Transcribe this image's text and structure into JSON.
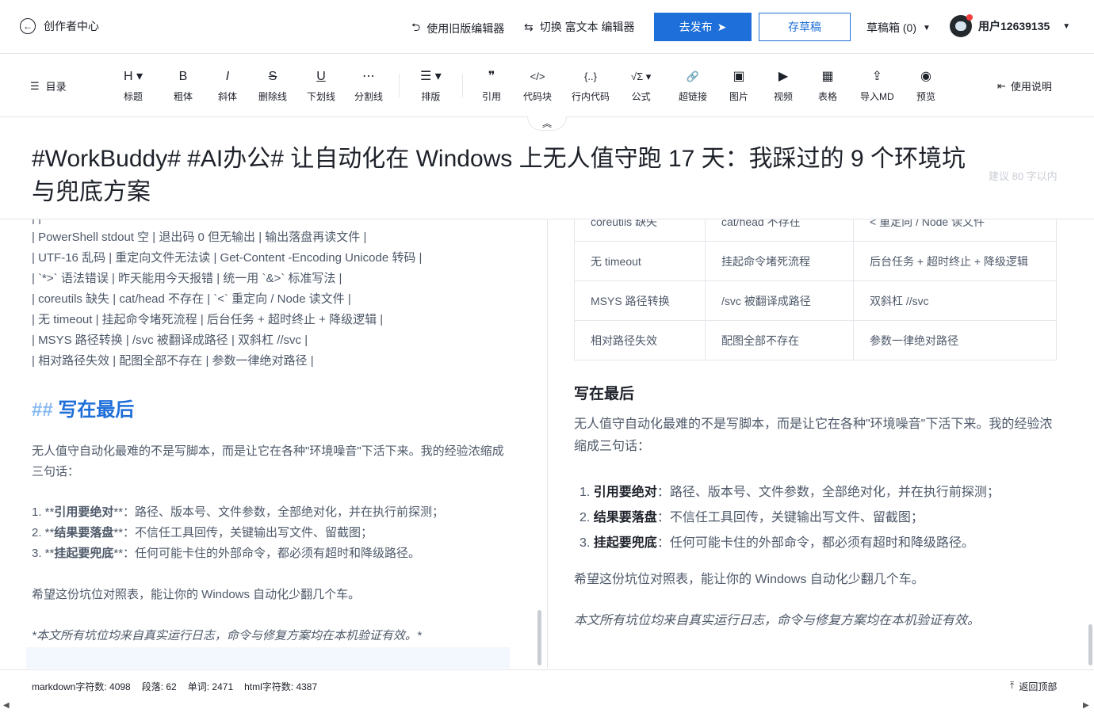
{
  "header": {
    "back_label": "创作者中心",
    "old_editor": "使用旧版编辑器",
    "switch_editor": "切换 富文本 编辑器",
    "publish": "去发布",
    "save_draft": "存草稿",
    "drafts": "草稿箱 (0)",
    "username": "用户12639135"
  },
  "toolbar": {
    "toc": "目录",
    "items": [
      {
        "icon": "H ▾",
        "label": "标题"
      },
      {
        "icon": "B",
        "label": "粗体"
      },
      {
        "icon": "I",
        "label": "斜体"
      },
      {
        "icon": "S",
        "label": "删除线"
      },
      {
        "icon": "U",
        "label": "下划线"
      },
      {
        "icon": "⋯",
        "label": "分割线"
      },
      {
        "icon": "☰ ▾",
        "label": "排版"
      },
      {
        "icon": "❞",
        "label": "引用"
      },
      {
        "icon": "</>",
        "label": "代码块"
      },
      {
        "icon": "{..}",
        "label": "行内代码"
      },
      {
        "icon": "√Σ ▾",
        "label": "公式"
      },
      {
        "icon": "🔗",
        "label": "超链接"
      },
      {
        "icon": "▣",
        "label": "图片"
      },
      {
        "icon": "▶",
        "label": "视频"
      },
      {
        "icon": "▦",
        "label": "表格"
      },
      {
        "icon": "⇪",
        "label": "导入MD"
      },
      {
        "icon": "◉",
        "label": "预览"
      }
    ],
    "manual": "使用说明"
  },
  "title": {
    "text": "#WorkBuddy# #AI办公# 让自动化在 Windows 上无人值守跑 17 天：我踩过的 9 个环境坑与兜底方案",
    "hint": "建议 80 字以内"
  },
  "editor": {
    "table_lines": [
      "| PowerShell stdout 空 | 退出码 0 但无输出 | 输出落盘再读文件 |",
      "| UTF-16 乱码 | 重定向文件无法读 | Get-Content -Encoding Unicode 转码 |",
      "| `*>` 语法错误 | 昨天能用今天报错 | 统一用 `&>` 标准写法 |",
      "| coreutils 缺失 | cat/head 不存在 | `<` 重定向 / Node 读文件 |",
      "| 无 timeout | 挂起命令堵死流程 | 后台任务 + 超时终止 + 降级逻辑 |",
      "| MSYS 路径转换 | /svc 被翻译成路径 | 双斜杠 //svc |",
      "| 相对路径失效 | 配图全部不存在 | 参数一律绝对路径 |"
    ],
    "heading_hash": "##",
    "heading_text": "写在最后",
    "intro": "无人值守自动化最难的不是写脚本，而是让它在各种\"环境噪音\"下活下来。我的经验浓缩成三句话：",
    "list": [
      {
        "prefix": "1. **",
        "bold": "引用要绝对",
        "rest": "**：路径、版本号、文件参数，全部绝对化，并在执行前探测；"
      },
      {
        "prefix": "2. **",
        "bold": "结果要落盘",
        "rest": "**：不信任工具回传，关键输出写文件、留截图；"
      },
      {
        "prefix": "3. **",
        "bold": "挂起要兜底",
        "rest": "**：任何可能卡住的外部命令，都必须有超时和降级路径。"
      }
    ],
    "closing": "希望这份坑位对照表，能让你的 Windows 自动化少翻几个车。",
    "note": "*本文所有坑位均来自真实运行日志，命令与修复方案均在本机验证有效。*"
  },
  "preview": {
    "table": [
      [
        "coreutils 缺失",
        "cat/head 不存在",
        "< 重定向 / Node 读文件"
      ],
      [
        "无 timeout",
        "挂起命令堵死流程",
        "后台任务 + 超时终止 + 降级逻辑"
      ],
      [
        "MSYS 路径转换",
        "/svc 被翻译成路径",
        "双斜杠 //svc"
      ],
      [
        "相对路径失效",
        "配图全部不存在",
        "参数一律绝对路径"
      ]
    ],
    "heading": "写在最后",
    "intro": "无人值守自动化最难的不是写脚本，而是让它在各种\"环境噪音\"下活下来。我的经验浓缩成三句话：",
    "list": [
      {
        "bold": "引用要绝对",
        "rest": "：路径、版本号、文件参数，全部绝对化，并在执行前探测；"
      },
      {
        "bold": "结果要落盘",
        "rest": "：不信任工具回传，关键输出写文件、留截图；"
      },
      {
        "bold": "挂起要兜底",
        "rest": "：任何可能卡住的外部命令，都必须有超时和降级路径。"
      }
    ],
    "closing": "希望这份坑位对照表，能让你的 Windows 自动化少翻几个车。",
    "note": "本文所有坑位均来自真实运行日志，命令与修复方案均在本机验证有效。"
  },
  "status": {
    "md_chars": "markdown字符数: 4098",
    "paragraphs": "段落: 62",
    "words": "单词: 2471",
    "html_chars": "html字符数: 4387",
    "back_top": "返回顶部"
  },
  "colors": {
    "accent": "#1e6fd9",
    "border": "#e5e6eb",
    "text": "#1d2129",
    "muted": "#4e5969"
  }
}
